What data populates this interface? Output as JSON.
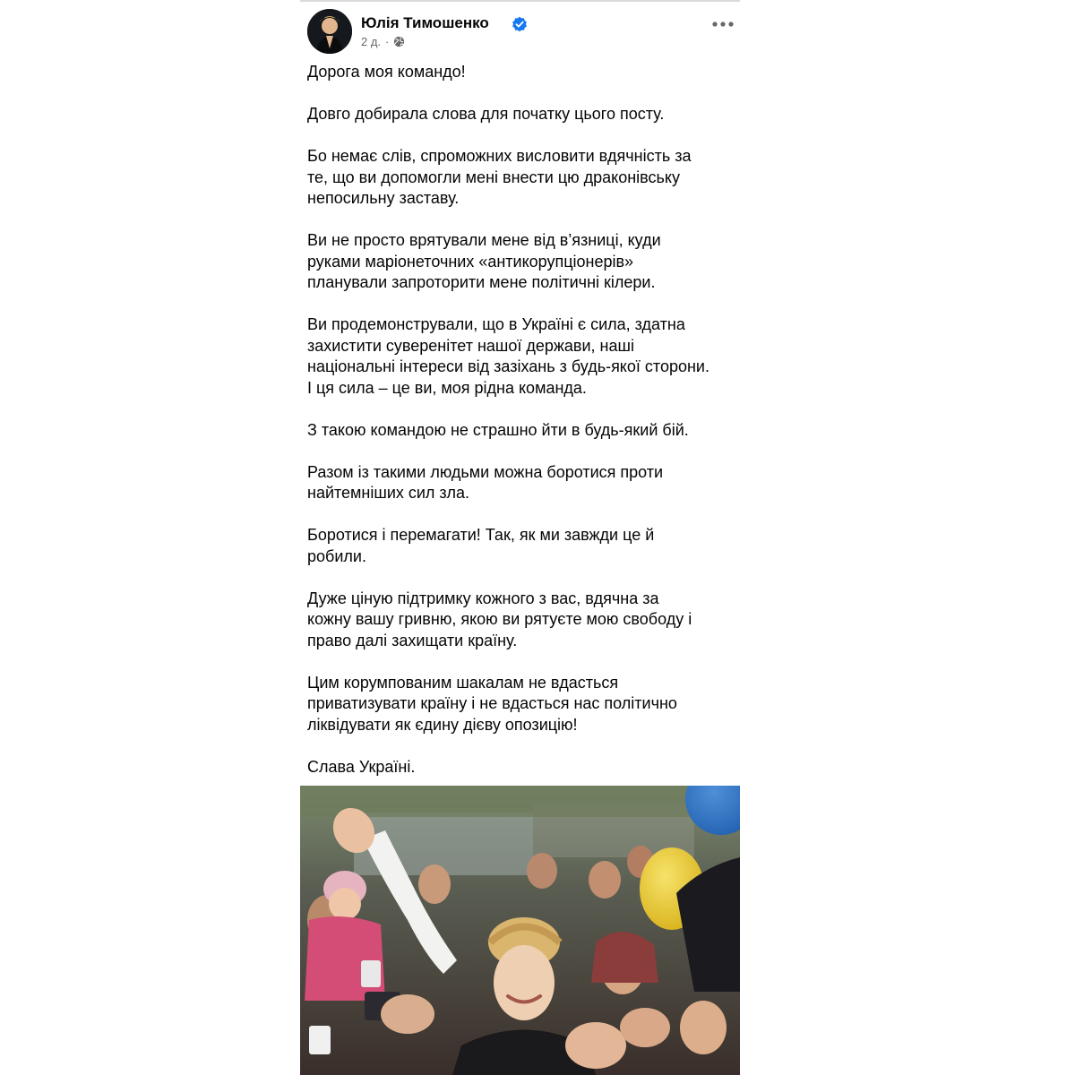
{
  "post": {
    "author": {
      "name": "Юлія Тимошенко",
      "verified_icon": "verified-badge-icon",
      "verified_color": "#1877f2"
    },
    "meta": {
      "time": "2 д.",
      "separator": "·",
      "audience_icon": "globe-icon"
    },
    "more_icon": "more-horizontal-icon",
    "paragraphs": [
      "Дорога моя командо!",
      "Довго добирала слова для початку цього посту.",
      "Бо немає слів, спроможних висловити вдячність за\nте, що ви допомогли мені внести цю драконівську\nнепосильну заставу.",
      "Ви не просто врятували мене від в’язниці, куди\nруками маріонеточних «антикорупціонерів»\nпланували запроторити мене політичні кілери.",
      "Ви продемонстрували, що в Україні є сила, здатна\nзахистити суверенітет нашої держави, наші\nнаціональні інтереси від зазіхань з будь-якої сторони.\nІ ця сила – це ви, моя рідна команда.",
      "З такою командою не страшно йти в будь-який бій.",
      "Разом із такими людьми можна боротися проти\nнайтемніших сил зла.",
      "Боротися і перемагати! Так, як ми завжди це й\nробили.",
      "Дуже ціную підтримку кожного з вас, вдячна за\nкожну вашу гривню, якою ви рятуєте мою свободу і\nправо далі захищати країну.",
      "Цим корумпованим шакалам не вдасться\nприватизувати країну і не вдасться нас політично\nліквідувати як єдину дієву опозицію!",
      "Слава Україні."
    ],
    "text_color": "#050505",
    "meta_color": "#65676b"
  }
}
